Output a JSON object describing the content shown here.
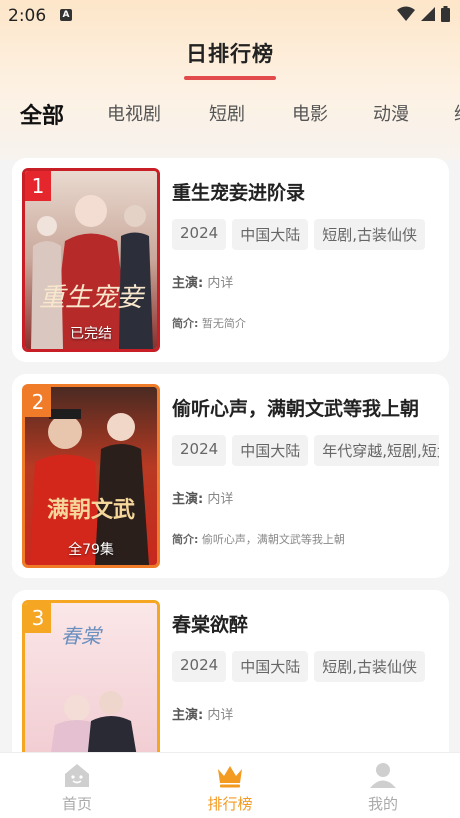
{
  "status_bar": {
    "time": "2:06",
    "notif_letter": "A"
  },
  "header": {
    "title": "日排行榜"
  },
  "tabs": [
    {
      "label": "全部",
      "active": true
    },
    {
      "label": "电视剧"
    },
    {
      "label": "短剧"
    },
    {
      "label": "电影"
    },
    {
      "label": "动漫"
    },
    {
      "label": "综"
    }
  ],
  "dramas": [
    {
      "rank": "1",
      "title": "重生宠妾进阶录",
      "status": "已完结",
      "tags": [
        "2024",
        "中国大陆",
        "短剧,古装仙侠"
      ],
      "cast_label": "主演:",
      "cast": "内详",
      "synopsis_label": "简介:",
      "synopsis": "暂无简介",
      "rank_color": "#e5262c"
    },
    {
      "rank": "2",
      "title": "偷听心声，满朝文武等我上朝",
      "status": "全79集",
      "tags": [
        "2024",
        "中国大陆",
        "年代穿越,短剧,短大"
      ],
      "cast_label": "主演:",
      "cast": "内详",
      "synopsis_label": "简介:",
      "synopsis": "偷听心声，满朝文武等我上朝",
      "rank_color": "#f07c2a"
    },
    {
      "rank": "3",
      "title": "春棠欲醉",
      "status": "",
      "tags": [
        "2024",
        "中国大陆",
        "短剧,古装仙侠"
      ],
      "cast_label": "主演:",
      "cast": "内详",
      "synopsis_label": "简介:",
      "synopsis": "",
      "rank_color": "#f5a623"
    }
  ],
  "bottom_nav": [
    {
      "label": "首页",
      "icon": "home-icon"
    },
    {
      "label": "排行榜",
      "icon": "crown-icon",
      "active": true
    },
    {
      "label": "我的",
      "icon": "user-icon"
    }
  ],
  "colors": {
    "accent": "#f39a21",
    "title_underline": "#e24b4b"
  }
}
